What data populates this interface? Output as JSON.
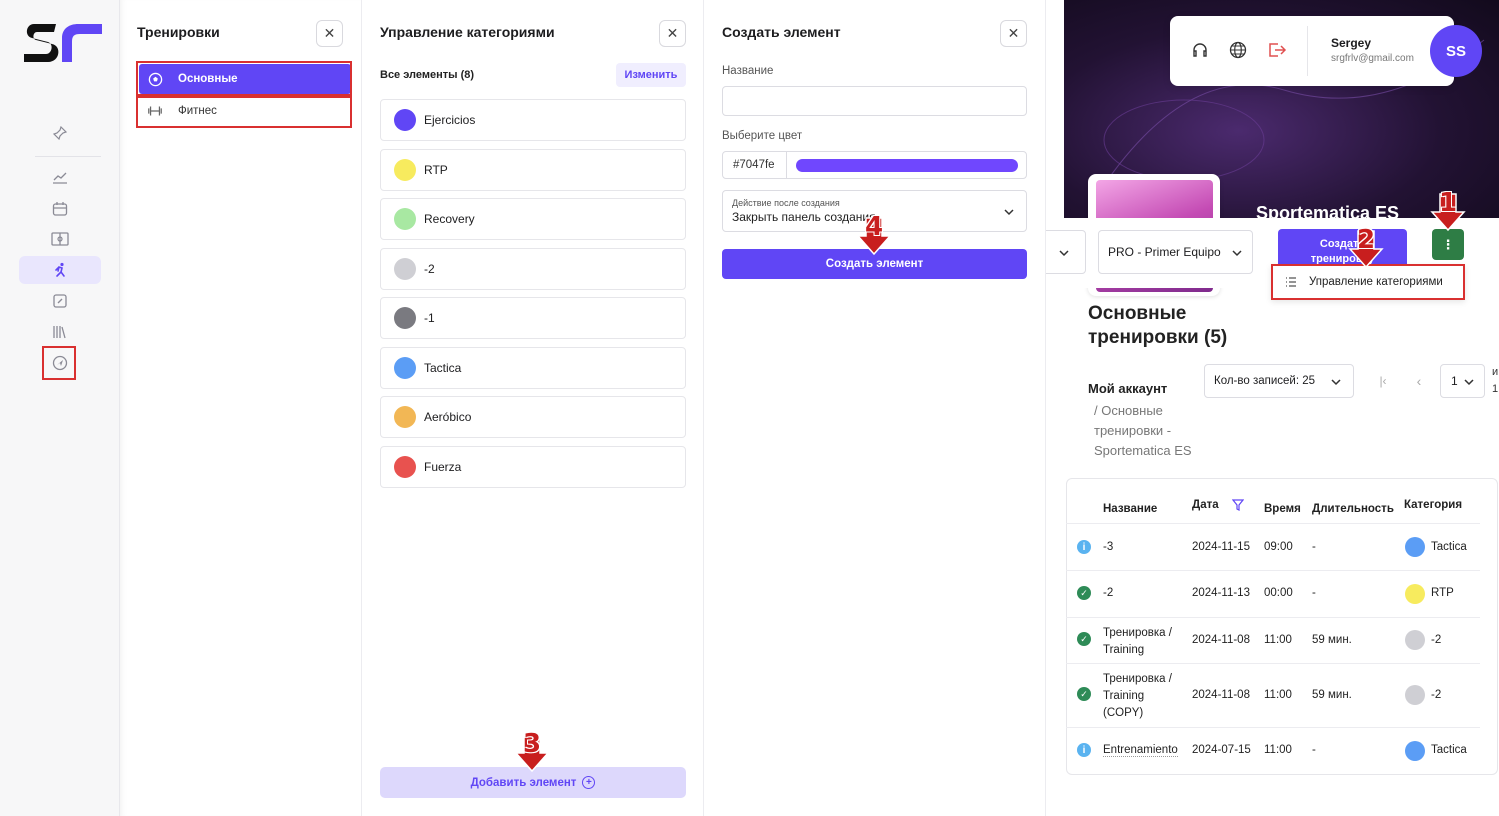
{
  "colors": {
    "accent": "#6046f5",
    "highlight_red": "#d93030",
    "category_ejercicios": "#6046f5",
    "category_rtp": "#f7eb5e",
    "category_recovery": "#a8e8a2",
    "category_minus2": "#cfcfd4",
    "category_minus1": "#7a7a80",
    "category_tactica": "#5b9df5",
    "category_aerobico": "#f2b755",
    "category_fuerza": "#e8524f"
  },
  "trainings_panel": {
    "title": "Тренировки",
    "items": [
      {
        "label": "Основные",
        "icon": "soccer-ball-icon",
        "active": true
      },
      {
        "label": "Фитнес",
        "icon": "dumbbell-icon",
        "active": false
      }
    ]
  },
  "categories_panel": {
    "title": "Управление категориями",
    "all_items_label": "Все элементы (8)",
    "edit_label": "Изменить",
    "categories": [
      {
        "name": "Ejercicios"
      },
      {
        "name": "RTP"
      },
      {
        "name": "Recovery"
      },
      {
        "name": "-2"
      },
      {
        "name": "-1"
      },
      {
        "name": "Tactica"
      },
      {
        "name": "Aeróbico"
      },
      {
        "name": "Fuerza"
      }
    ],
    "add_button_label": "Добавить элемент"
  },
  "create_panel": {
    "title": "Создать элемент",
    "name_label": "Название",
    "name_value": "",
    "color_label": "Выберите цвет",
    "color_value": "#7047fe",
    "action_label": "Действие после создания",
    "action_value": "Закрыть панель создания",
    "submit_label": "Создать элемент"
  },
  "header": {
    "user_name": "Sergey",
    "user_email": "srgfrlv@gmail.com",
    "avatar_initials": "SS",
    "team_name": "Sportematica ES"
  },
  "toolbar": {
    "team_select": "PRO - Primer Equipo",
    "create_button_line1": "Создать",
    "create_button_line2": "тренировку",
    "more_menu_item": "Управление категориями"
  },
  "page": {
    "title": "Основные тренировки (5)",
    "records_per_page": "Кол-во записей: 25",
    "page_number": "1",
    "breadcrumb_root": "Мой аккаунт",
    "breadcrumb_current": "/ Основные тренировки - Sportematica ES",
    "edge_text_1": "и",
    "edge_text_2": "1"
  },
  "table": {
    "headers": [
      "Название",
      "Дата",
      "Время",
      "Длительность",
      "Категория"
    ],
    "rows": [
      {
        "status": "info",
        "name": "-3",
        "date": "2024-11-15",
        "time": "09:00",
        "duration": "-",
        "category": "Tactica",
        "category_color": "#5b9df5"
      },
      {
        "status": "done",
        "name": "-2",
        "date": "2024-11-13",
        "time": "00:00",
        "duration": "-",
        "category": "RTP",
        "category_color": "#f7eb5e"
      },
      {
        "status": "done",
        "name": "Тренировка / Training",
        "date": "2024-11-08",
        "time": "11:00",
        "duration": "59 мин.",
        "category": "-2",
        "category_color": "#cfcfd4"
      },
      {
        "status": "done",
        "name": "Тренировка / Training (COPY)",
        "date": "2024-11-08",
        "time": "11:00",
        "duration": "59 мин.",
        "category": "-2",
        "category_color": "#cfcfd4"
      },
      {
        "status": "info",
        "name": "Entrenamiento",
        "date": "2024-07-15",
        "time": "11:00",
        "duration": "-",
        "category": "Tactica",
        "category_color": "#5b9df5"
      }
    ]
  },
  "step_markers": [
    "1",
    "2",
    "3",
    "4"
  ]
}
